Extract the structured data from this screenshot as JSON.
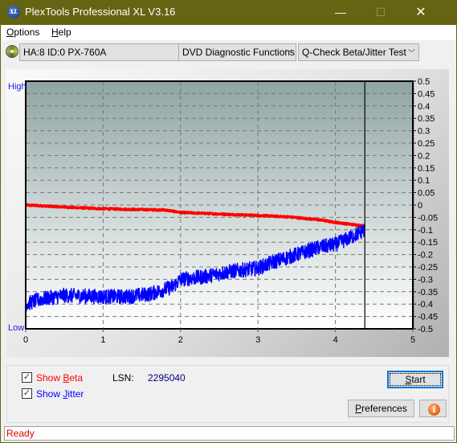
{
  "window": {
    "title": "PlexTools Professional XL V3.16",
    "app_icon_text": "XL",
    "minimize_glyph": "—",
    "maximize_glyph": "☐",
    "close_glyph": "✕"
  },
  "menu": {
    "items": [
      {
        "label": "Options",
        "mnemonic": "O",
        "rest": "ptions"
      },
      {
        "label": "Help",
        "mnemonic": "H",
        "rest": "elp"
      }
    ]
  },
  "toolbar": {
    "drive_icon": "disc-icon",
    "drive_select": "HA:8 ID:0  PX-760A",
    "function_select": "DVD Diagnostic Functions",
    "test_select": "Q-Check Beta/Jitter Test",
    "dropdown_glyph": "﹀"
  },
  "chart_data": {
    "type": "line",
    "title": "",
    "xlabel": "",
    "ylabel": "",
    "left_axis_labels": {
      "top": "High",
      "bottom": "Low"
    },
    "xlim": [
      0,
      5
    ],
    "ylim": [
      -0.5,
      0.5
    ],
    "x_ticks": [
      "0",
      "1",
      "2",
      "3",
      "4",
      "5"
    ],
    "y_ticks": [
      "0.5",
      "0.45",
      "0.4",
      "0.35",
      "0.3",
      "0.25",
      "0.2",
      "0.15",
      "0.1",
      "0.05",
      "0",
      "-0.05",
      "-0.1",
      "-0.15",
      "-0.2",
      "-0.25",
      "-0.3",
      "-0.35",
      "-0.4",
      "-0.45",
      "-0.5"
    ],
    "grid": true,
    "cursor_x": 4.38,
    "series": [
      {
        "name": "Beta",
        "color": "#ff0000",
        "x": [
          0,
          0.3,
          0.6,
          1.0,
          1.4,
          1.8,
          2.0,
          2.4,
          2.8,
          3.0,
          3.4,
          3.8,
          4.0,
          4.2,
          4.38
        ],
        "y": [
          0.0,
          -0.005,
          -0.01,
          -0.015,
          -0.018,
          -0.02,
          -0.03,
          -0.035,
          -0.04,
          -0.042,
          -0.048,
          -0.06,
          -0.07,
          -0.078,
          -0.085
        ],
        "noise": 0.004
      },
      {
        "name": "Jitter",
        "color": "#0000ff",
        "x": [
          0,
          0.2,
          0.5,
          1.0,
          1.3,
          1.6,
          1.9,
          2.0,
          2.3,
          2.6,
          3.0,
          3.2,
          3.5,
          3.8,
          4.0,
          4.2,
          4.38
        ],
        "y": [
          -0.4,
          -0.38,
          -0.365,
          -0.37,
          -0.37,
          -0.36,
          -0.33,
          -0.3,
          -0.29,
          -0.27,
          -0.255,
          -0.23,
          -0.2,
          -0.17,
          -0.16,
          -0.13,
          -0.1
        ],
        "noise": 0.03
      }
    ]
  },
  "controls": {
    "show_beta": {
      "label_pre": "Show ",
      "mnemonic": "B",
      "label_post": "eta",
      "checked": true,
      "color": "#ff0000"
    },
    "show_jitter": {
      "label_pre": "Show ",
      "mnemonic": "J",
      "label_post": "itter",
      "checked": true,
      "color": "#0000ff"
    },
    "lsn_label": "LSN:",
    "lsn_value": "2295040",
    "start_button": {
      "mnemonic": "S",
      "rest": "tart"
    },
    "preferences_button": {
      "mnemonic": "P",
      "rest": "references"
    },
    "info_button_glyph": "i",
    "check_glyph": "✓"
  },
  "status": {
    "text": "Ready"
  }
}
